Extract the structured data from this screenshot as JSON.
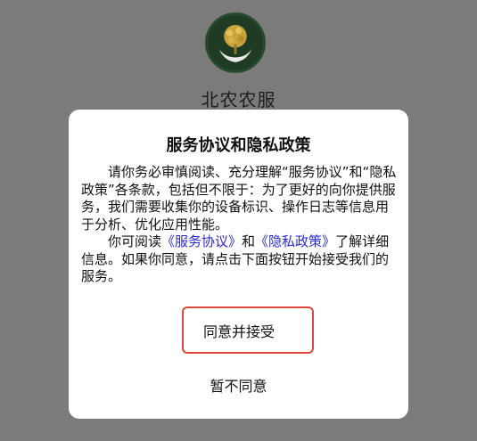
{
  "app": {
    "name": "北农农服"
  },
  "dialog": {
    "title": "服务协议和隐私政策",
    "para1": "请你务必审慎阅读、充分理解“服务协议”和“隐私政策”各条款，包括但不限于：为了更好的向你提供服务，我们需要收集你的设备标识、操作日志等信息用于分析、优化应用性能。",
    "para2_prefix": "你可阅读",
    "link_service": "《服务协议》",
    "para2_and": "和",
    "link_privacy": "《隐私政策》",
    "para2_suffix": "了解详细信息。如果你同意，请点击下面按钮开始接受我们的服务。",
    "accept_label": "同意并接受",
    "decline_label": "暂不同意"
  },
  "colors": {
    "overlay": "#7b7b7b",
    "link": "#2a2ad0",
    "highlight": "#e0473c"
  }
}
